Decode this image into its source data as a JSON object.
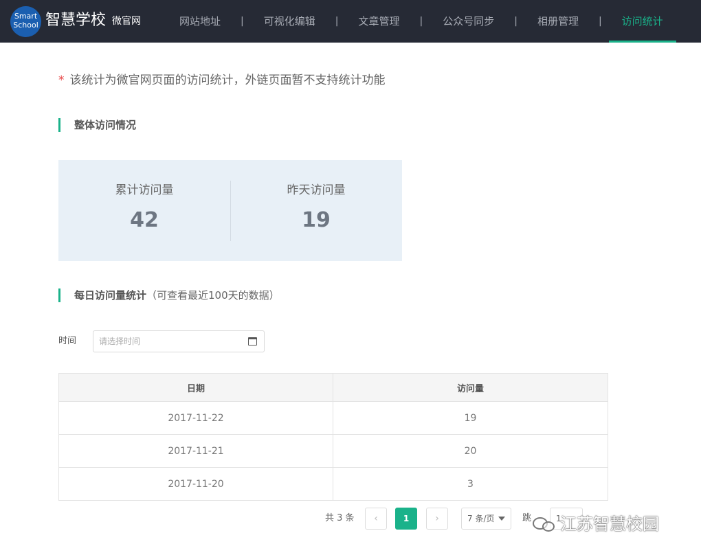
{
  "header": {
    "logo_line1": "Smart",
    "logo_line2": "School",
    "brand": "智慧学校",
    "brand_sub": "微官网",
    "nav": [
      {
        "label": "网站地址"
      },
      {
        "label": "可视化编辑"
      },
      {
        "label": "文章管理"
      },
      {
        "label": "公众号同步"
      },
      {
        "label": "相册管理"
      },
      {
        "label": "访问统计"
      }
    ],
    "separator": "|",
    "active_index": 5
  },
  "notice": {
    "star": "*",
    "text": "该统计为微官网页面的访问统计，外链页面暂不支持统计功能"
  },
  "overview": {
    "title": "整体访问情况",
    "total_label": "累计访问量",
    "total_value": "42",
    "yesterday_label": "昨天访问量",
    "yesterday_value": "19"
  },
  "daily": {
    "title": "每日访问量统计",
    "hint": "（可查看最近100天的数据）",
    "filter_label": "时间",
    "date_placeholder": "请选择时间"
  },
  "table": {
    "headers": [
      "日期",
      "访问量"
    ],
    "rows": [
      [
        "2017-11-22",
        "19"
      ],
      [
        "2017-11-21",
        "20"
      ],
      [
        "2017-11-20",
        "3"
      ]
    ]
  },
  "pagination": {
    "total": "共 3 条",
    "prev": "‹",
    "current": "1",
    "next": "›",
    "page_size": "7 条/页",
    "jump_label": "跳",
    "jump_value": "1"
  },
  "watermark": {
    "text": "江苏智慧校园"
  },
  "colors": {
    "accent": "#1ab28a",
    "topbar": "#262a35",
    "stats_bg": "#e8f0f7",
    "required": "#e84a4a"
  }
}
